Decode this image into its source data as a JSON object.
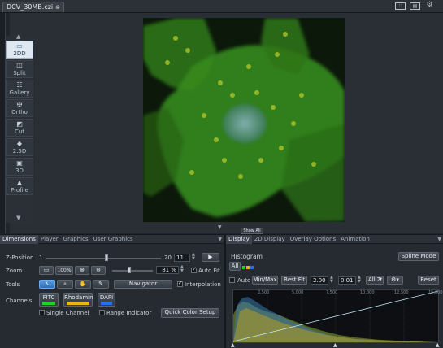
{
  "window": {
    "doc_tab": "DCV_30MB.czi"
  },
  "sidebar": {
    "items": [
      {
        "label": "2DD",
        "icon": "view-2d-icon"
      },
      {
        "label": "Split",
        "icon": "split-view-icon"
      },
      {
        "label": "Gallery",
        "icon": "gallery-icon"
      },
      {
        "label": "Ortho",
        "icon": "ortho-icon"
      },
      {
        "label": "Cut",
        "icon": "cut-icon"
      },
      {
        "label": "2.5D",
        "icon": "view-25d-icon"
      },
      {
        "label": "3D",
        "icon": "view-3d-icon"
      },
      {
        "label": "Profile",
        "icon": "profile-icon"
      }
    ]
  },
  "image_toggle": "Show All",
  "left_tabs": [
    "Dimensions",
    "Player",
    "Graphics",
    "User Graphics"
  ],
  "right_tabs": [
    "Display",
    "2D Display",
    "Overlay Options",
    "Animation"
  ],
  "dimensions": {
    "z_label": "Z-Position",
    "z_min": "1",
    "z_max": "20",
    "z_value": "11",
    "z_fraction": 0.53,
    "zoom_label": "Zoom",
    "zoom_btn_100": "100%",
    "zoom_value": "81 %",
    "zoom_fraction": 0.42,
    "autofit_label": "Auto Fit",
    "tools_label": "Tools",
    "navigator_label": "Navigator",
    "interpolation_label": "Interpolation",
    "channels_label": "Channels",
    "channels": [
      {
        "name": "FITC",
        "color": "#22d22a"
      },
      {
        "name": "Rhodamin",
        "color": "#e8b80d"
      },
      {
        "name": "DAPI",
        "color": "#2a6df0"
      }
    ],
    "single_channel_label": "Single Channel",
    "range_indicator_label": "Range Indicator",
    "quick_color_label": "Quick Color Setup"
  },
  "display": {
    "histogram_label": "Histogram",
    "spline_label": "Spline Mode",
    "all_label": "All",
    "auto_label": "Auto",
    "minmax_label": "Min/Max",
    "bestfit_label": "Best Fit",
    "gamma_value": "2.00",
    "threshold_value": "0.01",
    "allz_label": "All Z",
    "reset_label": "Reset",
    "axis_ticks": [
      "2,500",
      "5,000",
      "7,500",
      "10,000",
      "12,500",
      "15,000"
    ]
  }
}
